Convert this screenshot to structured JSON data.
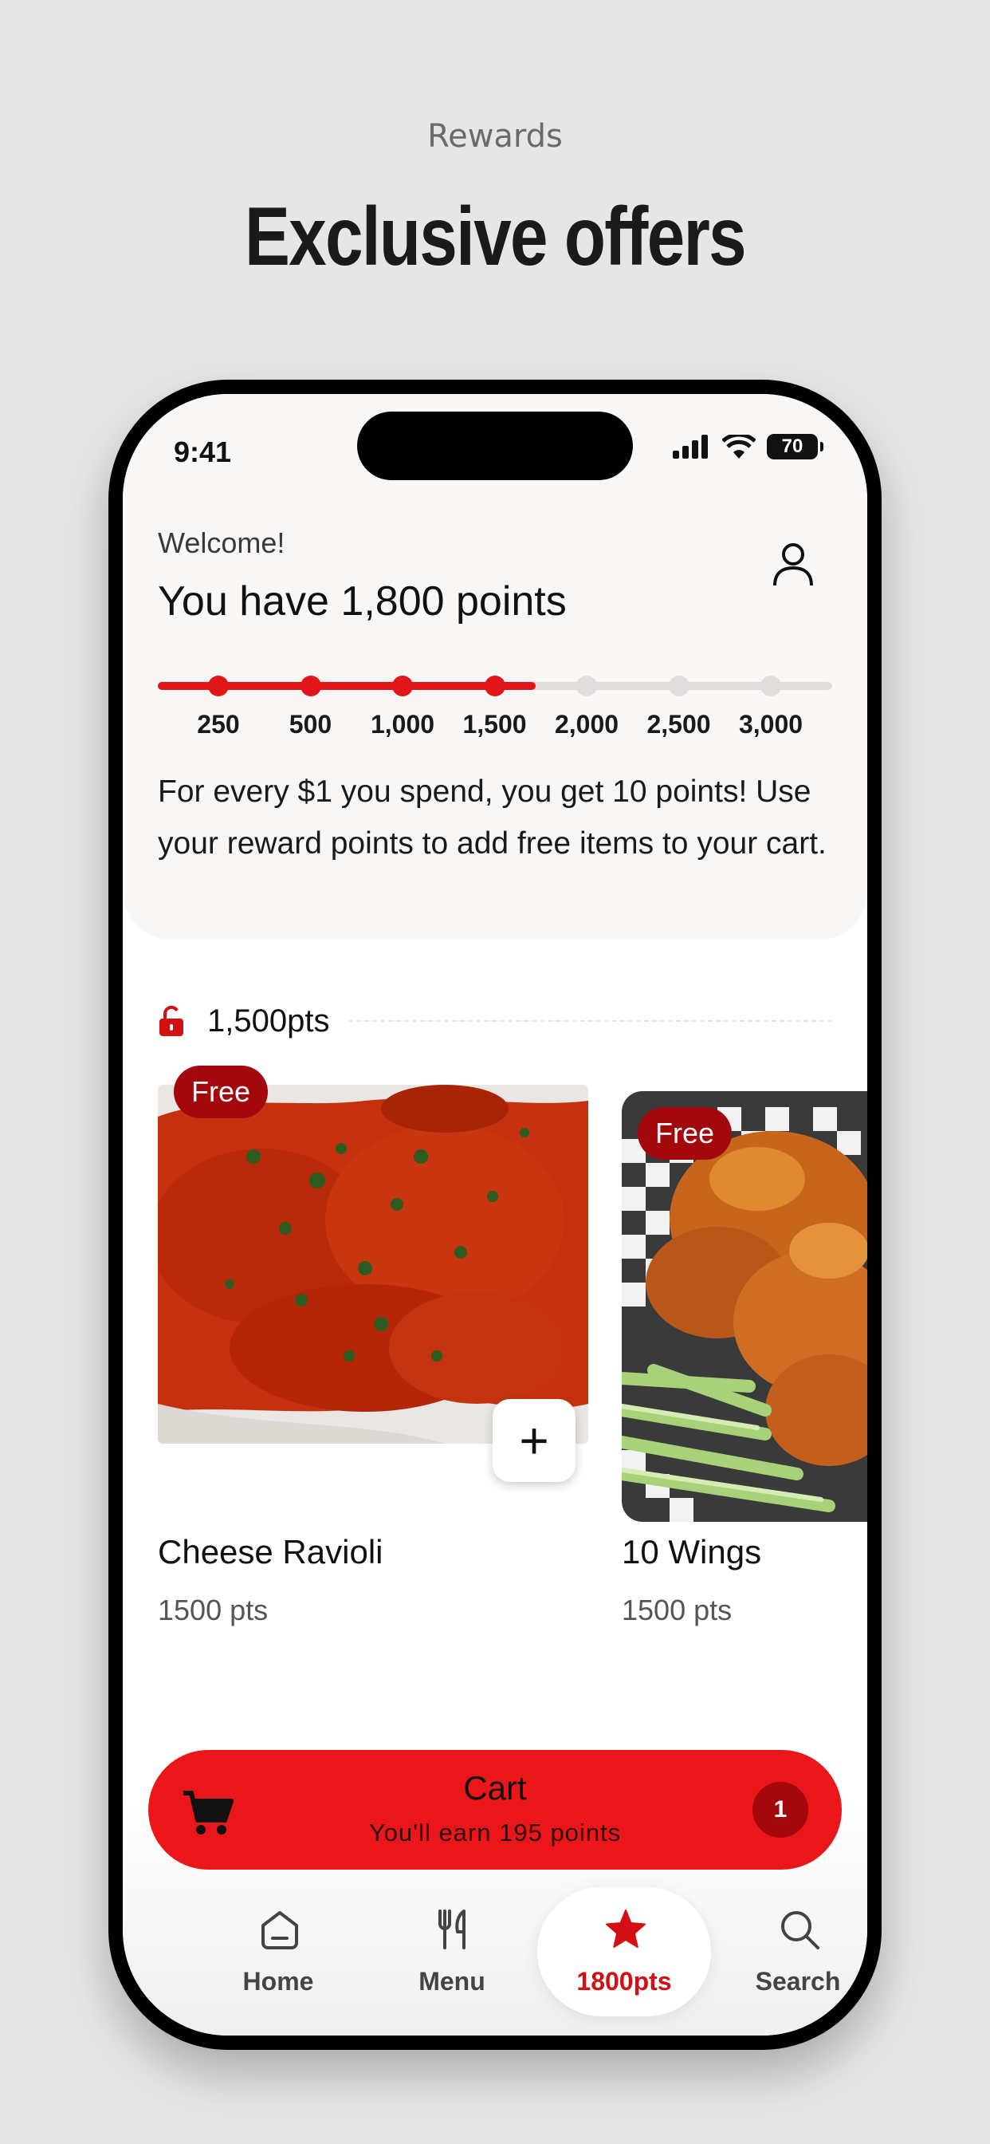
{
  "promo": {
    "label": "Rewards",
    "title": "Exclusive offers"
  },
  "status_bar": {
    "time": "9:41",
    "battery": "70"
  },
  "header": {
    "welcome": "Welcome!",
    "points_title": "You have 1,800 points",
    "info": "For every $1 you spend, you get 10 points! Use your reward points to add free items to your cart."
  },
  "progress": {
    "current_points": 1800,
    "max_points": 3000,
    "fill_fraction": 0.56,
    "milestones": [
      "250",
      "500",
      "1,000",
      "1,500",
      "2,000",
      "2,500",
      "3,000"
    ],
    "reached": 4
  },
  "tier": {
    "label": "1,500pts",
    "icon": "unlocked-lock-icon"
  },
  "items": [
    {
      "name": "Cheese Ravioli",
      "points": "1500 pts",
      "badge": "Free",
      "add_label": "+"
    },
    {
      "name": "10 Wings",
      "points": "1500 pts",
      "badge": "Free"
    }
  ],
  "cart": {
    "title": "Cart",
    "subtitle": "You'll earn 195 points",
    "count": "1"
  },
  "tabs": [
    {
      "label": "Home",
      "icon": "home-icon"
    },
    {
      "label": "Menu",
      "icon": "fork-knife-icon"
    },
    {
      "label": "1800pts",
      "icon": "star-icon",
      "active": true
    },
    {
      "label": "Search",
      "icon": "search-icon"
    }
  ],
  "colors": {
    "accent": "#ea1619",
    "badge": "#a3080d",
    "active_tab": "#d40f14"
  }
}
